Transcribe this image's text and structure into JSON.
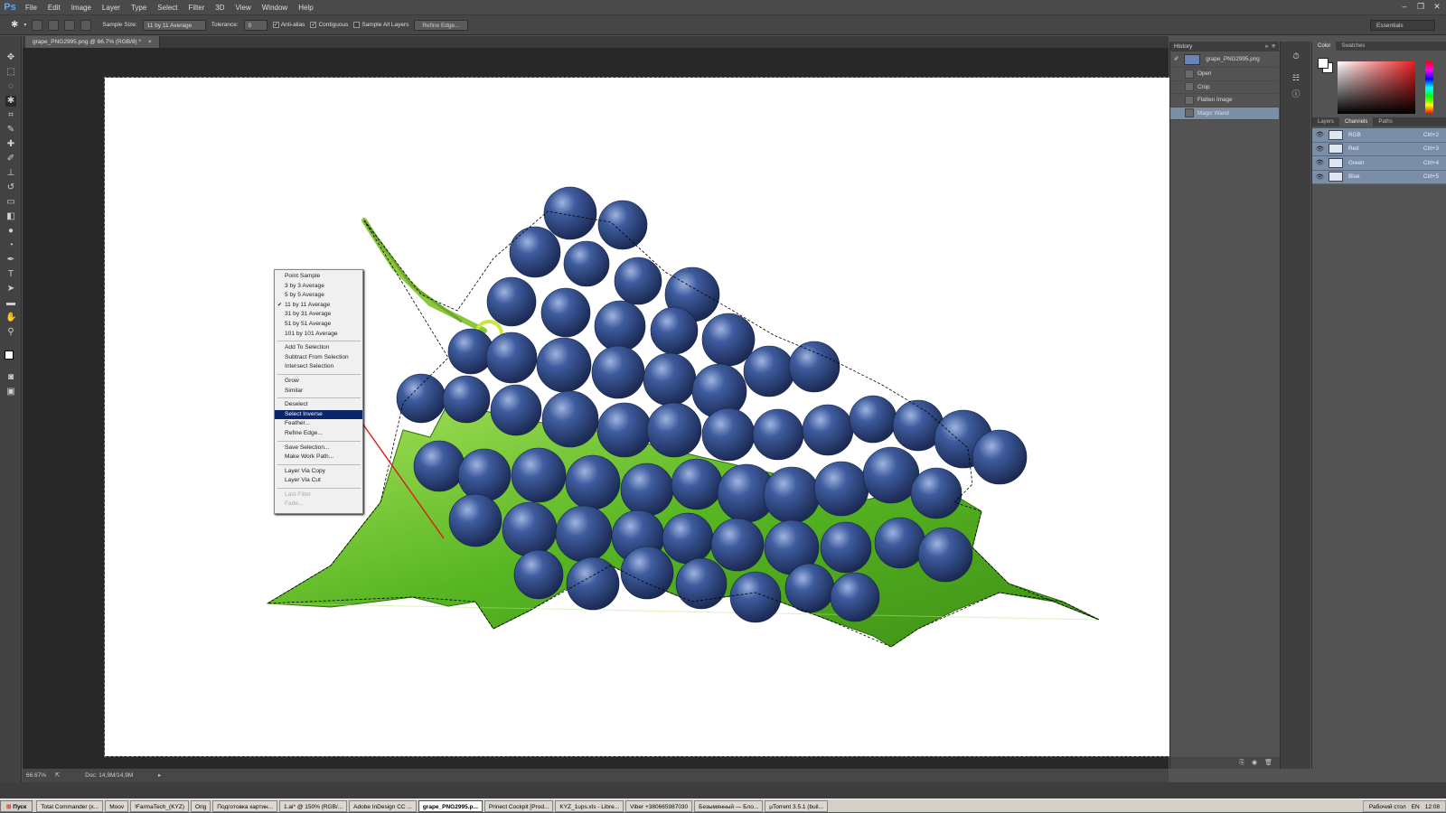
{
  "app": {
    "logo": "Ps"
  },
  "menu": [
    "File",
    "Edit",
    "Image",
    "Layer",
    "Type",
    "Select",
    "Filter",
    "3D",
    "View",
    "Window",
    "Help"
  ],
  "options": {
    "sample_size_label": "Sample Size:",
    "sample_size_value": "11 by 11 Average",
    "tolerance_label": "Tolerance:",
    "tolerance_value": "0",
    "anti_alias": "Anti-alias",
    "contiguous": "Contiguous",
    "sample_all_layers": "Sample All Layers",
    "refine_edge": "Refine Edge...",
    "workspace": "Essentials"
  },
  "document": {
    "tab": "grape_PNG2995.png @ 66.7% (RGB/8) *"
  },
  "status": {
    "zoom": "66.67%",
    "doc": "Doc: 14,9M/14,9M"
  },
  "context_menu": {
    "groups": [
      [
        {
          "label": "Point Sample"
        },
        {
          "label": "3 by 3 Average"
        },
        {
          "label": "5 by 5 Average"
        },
        {
          "label": "11 by 11 Average",
          "checked": true
        },
        {
          "label": "31 by 31 Average"
        },
        {
          "label": "51 by 51 Average"
        },
        {
          "label": "101 by 101 Average"
        }
      ],
      [
        {
          "label": "Add To Selection"
        },
        {
          "label": "Subtract From Selection"
        },
        {
          "label": "Intersect Selection"
        }
      ],
      [
        {
          "label": "Grow"
        },
        {
          "label": "Similar"
        }
      ],
      [
        {
          "label": "Deselect"
        },
        {
          "label": "Select Inverse",
          "highlighted": true
        },
        {
          "label": "Feather..."
        },
        {
          "label": "Refine Edge..."
        }
      ],
      [
        {
          "label": "Save Selection..."
        },
        {
          "label": "Make Work Path..."
        }
      ],
      [
        {
          "label": "Layer Via Copy"
        },
        {
          "label": "Layer Via Cut"
        }
      ],
      [
        {
          "label": "Last Filter",
          "disabled": true
        },
        {
          "label": "Fade...",
          "disabled": true
        }
      ]
    ]
  },
  "history": {
    "title": "History",
    "snapshot": "grape_PNG2995.png",
    "items": [
      {
        "label": "Open"
      },
      {
        "label": "Crop"
      },
      {
        "label": "Flatten Image"
      },
      {
        "label": "Magic Wand",
        "active": true
      }
    ]
  },
  "color_panel": {
    "tabs": [
      "Color",
      "Swatches"
    ]
  },
  "layers_panel": {
    "tabs": [
      "Layers",
      "Channels",
      "Paths"
    ],
    "channels": [
      {
        "name": "RGB",
        "shortcut": "Ctrl+2"
      },
      {
        "name": "Red",
        "shortcut": "Ctrl+3"
      },
      {
        "name": "Green",
        "shortcut": "Ctrl+4"
      },
      {
        "name": "Blue",
        "shortcut": "Ctrl+5"
      }
    ]
  },
  "taskbar": {
    "start": "Пуск",
    "items": [
      {
        "label": "Total Commander (x..."
      },
      {
        "label": "Moov"
      },
      {
        "label": "!FarmaTech_(KYZ)"
      },
      {
        "label": "Orig"
      },
      {
        "label": "Подготовка картин..."
      },
      {
        "label": "1.ai* @ 150% (RGB/..."
      },
      {
        "label": "Adobe InDesign CC ..."
      },
      {
        "label": "grape_PNG2995.p...",
        "active": true
      },
      {
        "label": "Prinect Cockpit [Prod..."
      },
      {
        "label": "KYZ_1ups.xls - Libre..."
      },
      {
        "label": "Viber +380665987030"
      },
      {
        "label": "Безымянный — Бло..."
      },
      {
        "label": "µTorrent 3.5.1 (buil..."
      }
    ],
    "desktop": "Рабочий стол",
    "lang": "EN",
    "time": "12:08"
  }
}
